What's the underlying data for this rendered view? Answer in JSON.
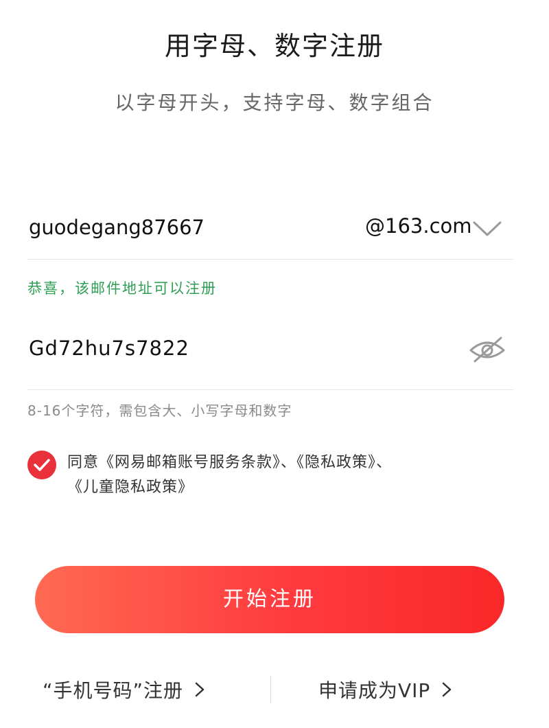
{
  "header": {
    "title": "用字母、数字注册",
    "subtitle": "以字母开头，支持字母、数字组合"
  },
  "email": {
    "username_value": "guodegang87667",
    "domain": "@163.com",
    "dropdown_icon": "chevron-down-icon",
    "status_message": "恭喜，该邮件地址可以注册",
    "status_color": "#2f9e55"
  },
  "password": {
    "value": "Gd72hu7s7822",
    "visibility_icon": "eye-off-icon",
    "hint": "8-16个字符，需包含大、小写字母和数字"
  },
  "agreement": {
    "checked": true,
    "prefix": "同意",
    "terms_link": "《网易邮箱账号服务条款》",
    "separator_1": "、",
    "privacy_link": "《隐私政策》",
    "separator_2": "、",
    "children_link": "《儿童隐私政策》",
    "check_color": "#e8313a"
  },
  "actions": {
    "primary_label": "开始注册",
    "phone_register_label": "“手机号码”注册",
    "vip_label": "申请成为VIP"
  },
  "colors": {
    "button_gradient_start": "#ff6a52",
    "button_gradient_end": "#f92828"
  }
}
